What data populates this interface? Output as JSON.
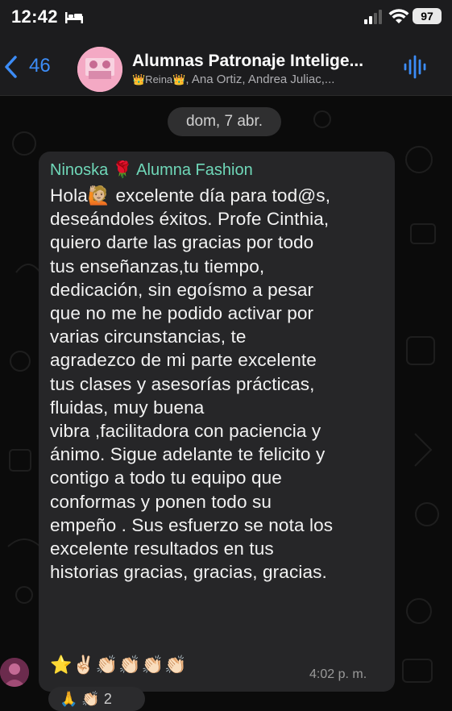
{
  "status_bar": {
    "time": "12:42",
    "battery": "97"
  },
  "header": {
    "back_count": "46",
    "title": "Alumnas Patronaje Intelige...",
    "members_prefix": "👑Reina👑",
    "members_rest": ", Ana Ortiz, Andrea Juliac,..."
  },
  "date_separator": "dom, 7 abr.",
  "message": {
    "sender": "Ninoska 🌹 Alumna Fashion",
    "text": "Hola🙋🏼 excelente día para tod@s,\ndeseándoles éxitos. Profe Cinthia,\nquiero darte las gracias por todo\ntus enseñanzas,tu tiempo,\ndedicación, sin egoísmo a pesar\nque no me he podido activar por\nvarias circunstancias, te\nagradezco de mi parte excelente\ntus clases y asesorías prácticas,\nfluidas, muy buena\nvibra   ,facilitadora con paciencia y\nánimo. Sigue adelante te felicito y\ncontigo a todo tu equipo que\nconformas y ponen todo su\nempeño . Sus esfuerzo se nota los\nexcelente resultados en tus\nhistorias gracias, gracias, gracias.",
    "emojis": "⭐✌🏻👏🏻👏🏻👏🏻👏🏻",
    "time": "4:02 p. m."
  },
  "reactions": "🙏 👏🏻 2",
  "colors": {
    "accent_blue": "#3c8cf6",
    "sender_name": "#6fd7b8",
    "bubble": "#262628"
  }
}
